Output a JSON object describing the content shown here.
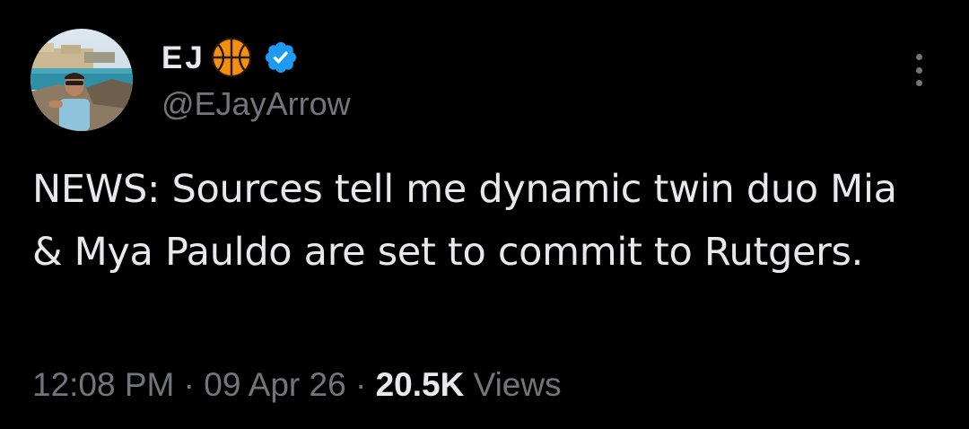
{
  "author": {
    "display_name": "EJ",
    "emoji_icon": "basketball-icon",
    "verified_icon": "verified-badge-icon",
    "handle": "@EJayArrow"
  },
  "tweet": {
    "text": "NEWS: Sources tell me dynamic twin duo Mia & Mya Pauldo are set to commit to Rutgers."
  },
  "meta": {
    "time": "12:08 PM",
    "separator": "·",
    "date": "09 Apr 26",
    "views_count": "20.5K",
    "views_label": "Views"
  },
  "colors": {
    "background": "#000000",
    "text": "#e7e9ea",
    "secondary": "#71767b",
    "verified": "#1d9bf0",
    "basketball": "#f4900c"
  }
}
